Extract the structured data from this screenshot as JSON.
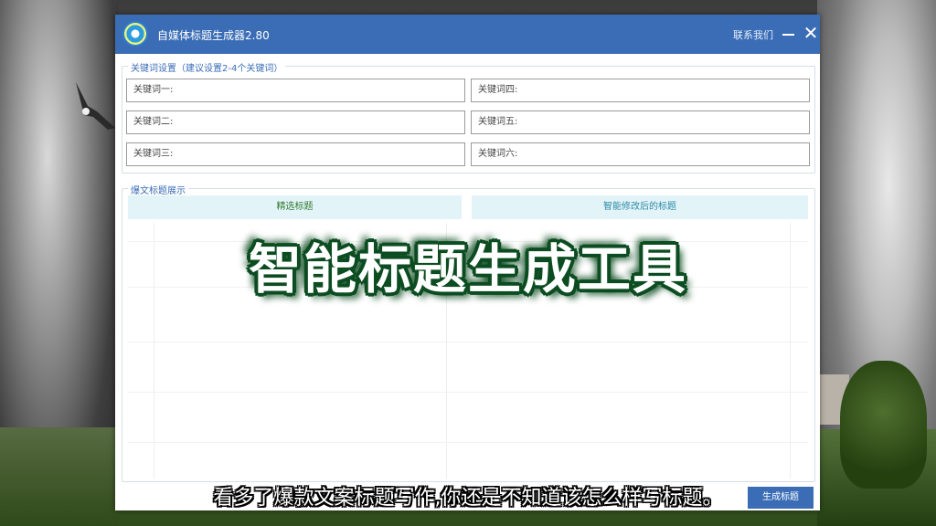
{
  "window": {
    "title": "自媒体标题生成器2.80",
    "contact_label": "联系我们",
    "close_glyph": "✕"
  },
  "keywords_section": {
    "legend": "关键词设置（建议设置2-4个关键词）",
    "fields": [
      {
        "label": "关键词一:"
      },
      {
        "label": "关键词二:"
      },
      {
        "label": "关键词三:"
      },
      {
        "label": "关键词四:"
      },
      {
        "label": "关键词五:"
      },
      {
        "label": "关键词六:"
      }
    ]
  },
  "titles_section": {
    "legend": "爆文标题展示",
    "left_column": "精选标题",
    "right_column": "智能修改后的标题"
  },
  "generate_button": "生成标题",
  "overlay_title": "智能标题生成工具",
  "subtitle": "看多了爆款文案标题写作,你还是不知道该怎么样写标题。",
  "colors": {
    "titlebar": "#3a6db6",
    "overlay_outline": "#0d4d22",
    "column_header_bg": "#e3f4f8"
  }
}
